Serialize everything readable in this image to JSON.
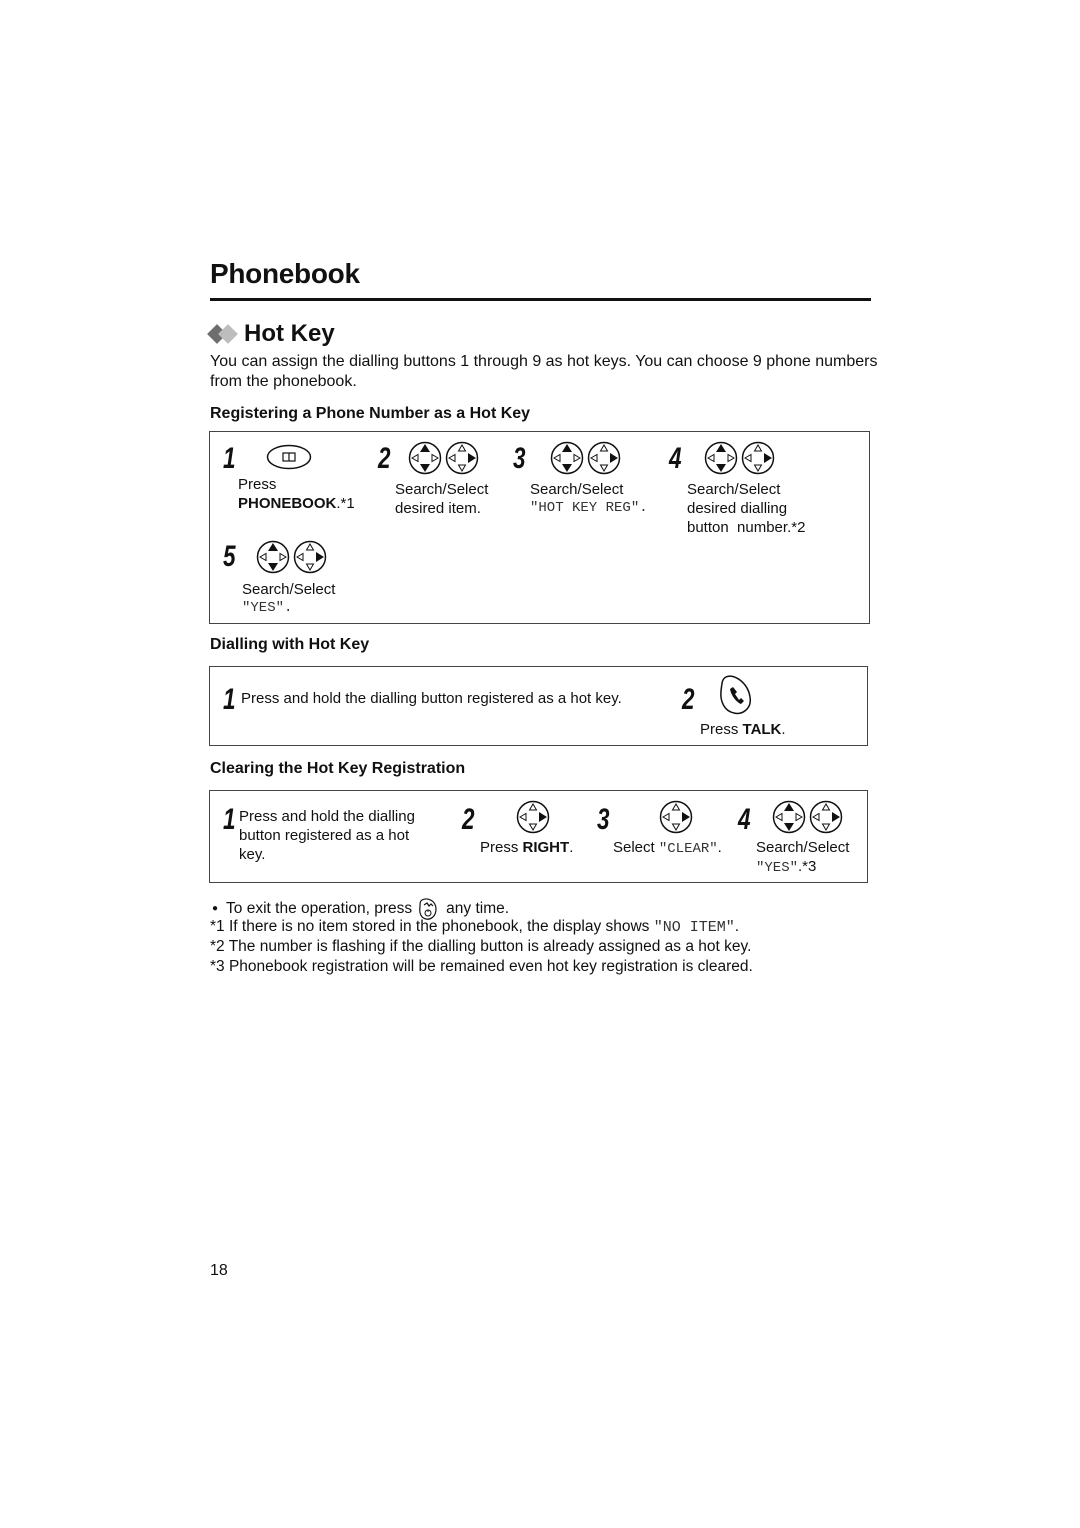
{
  "page": {
    "chapter_title": "Phonebook",
    "section_title": "Hot Key",
    "intro": "You can assign the dialling buttons 1 through 9 as hot keys. You can choose 9 phone numbers from the phonebook.",
    "page_number": "18",
    "accent_colors": {
      "diamond_dark": "#6e6e6e",
      "diamond_light": "#bdbdbd"
    }
  },
  "register": {
    "heading": "Registering a Phone Number as a Hot Key",
    "steps": [
      {
        "num": "1",
        "icon": "phonebook-button-icon",
        "line1": "Press",
        "bold": "PHONEBOOK",
        "suffix": ".*1"
      },
      {
        "num": "2",
        "icon": "navigator-up-down-right-icon",
        "line1": "Search/Select",
        "line2": "desired item."
      },
      {
        "num": "3",
        "icon": "navigator-up-down-right-icon",
        "line1": "Search/Select",
        "display": "\"HOT KEY REG\"."
      },
      {
        "num": "4",
        "icon": "navigator-up-down-right-icon",
        "line1": "Search/Select",
        "line2": "desired dialling",
        "line3": "button  number.*2"
      },
      {
        "num": "5",
        "icon": "navigator-up-down-right-icon",
        "line1": "Search/Select",
        "display": "\"YES\"."
      }
    ]
  },
  "dialling": {
    "heading": "Dialling with Hot Key",
    "steps": [
      {
        "num": "1",
        "text": "Press and hold the dialling button registered as a hot key."
      },
      {
        "num": "2",
        "icon": "talk-button-icon",
        "prefix": "Press ",
        "bold": "TALK",
        "suffix": "."
      }
    ]
  },
  "clearing": {
    "heading": "Clearing the Hot Key Registration",
    "steps": [
      {
        "num": "1",
        "text": "Press and hold the dialling button registered as a hot key."
      },
      {
        "num": "2",
        "icon": "navigator-right-icon",
        "prefix": "Press ",
        "bold": "RIGHT",
        "suffix": "."
      },
      {
        "num": "3",
        "icon": "navigator-right-icon",
        "prefix": "Select ",
        "display": "\"CLEAR\"",
        "suffix": "."
      },
      {
        "num": "4",
        "icon": "navigator-up-down-right-icon",
        "line1": "Search/Select",
        "display": "\"YES\"",
        "suffix": ".*3"
      }
    ]
  },
  "notes": {
    "bullet_prefix": "To exit the operation, press",
    "bullet_suffix": "any time.",
    "footnotes": [
      {
        "mark": "*1",
        "text": "If there is no item stored in the phonebook, the display shows ",
        "display": "\"NO ITEM\"",
        "end": "."
      },
      {
        "mark": "*2",
        "text": "The number is flashing if the dialling button is already assigned as a hot key."
      },
      {
        "mark": "*3",
        "text": "Phonebook registration will be remained even hot key registration is cleared."
      }
    ]
  }
}
